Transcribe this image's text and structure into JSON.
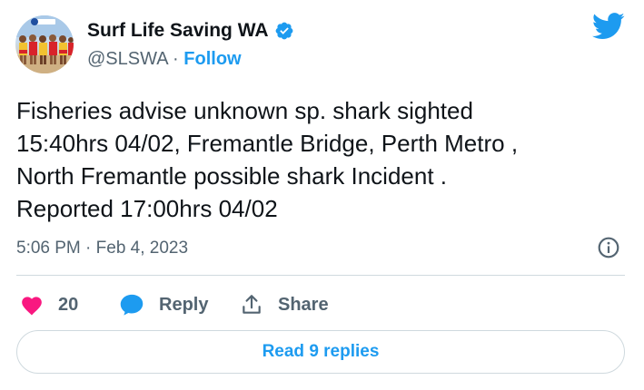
{
  "author": {
    "display_name": "Surf Life Saving WA",
    "handle": "@SLSWA",
    "separator": " · ",
    "follow_label": "Follow",
    "avatar_icon": "group-of-lifesavers-avatar",
    "verified_icon": "verified-badge-icon"
  },
  "tweet": {
    "lines": [
      "Fisheries advise unknown sp. shark sighted",
      "15:40hrs 04/02, Fremantle Bridge, Perth Metro ,",
      "North Fremantle possible shark Incident .",
      "Reported 17:00hrs 04/02"
    ],
    "timestamp": "5:06 PM · Feb 4, 2023"
  },
  "actions": {
    "like_count": "20",
    "reply_label": "Reply",
    "share_label": "Share"
  },
  "footer": {
    "read_replies_label": "Read 9 replies"
  },
  "colors": {
    "accent": "#1d9bf0",
    "like": "#f91880",
    "text": "#0f1419",
    "muted": "#536471",
    "border": "#cfd9de"
  }
}
